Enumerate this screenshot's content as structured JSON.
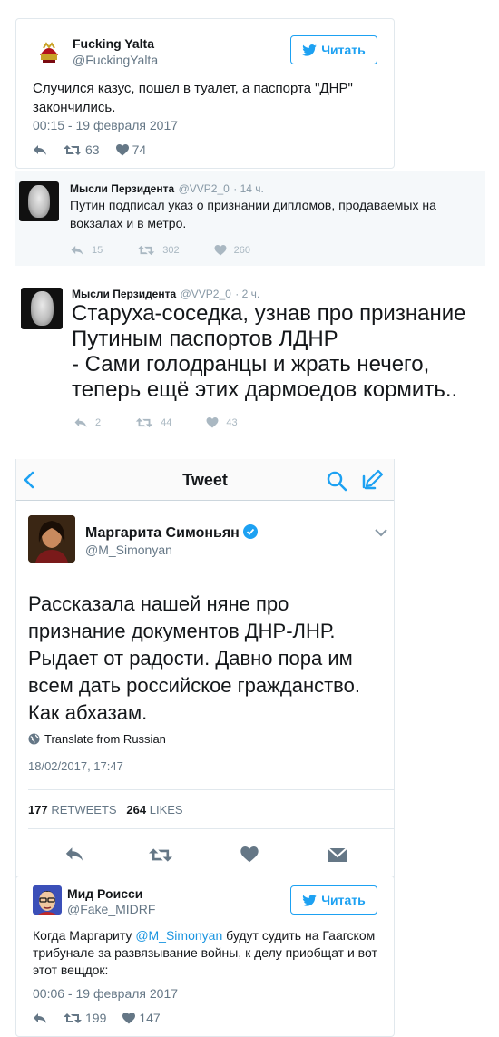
{
  "colors": {
    "accent": "#1da1f2",
    "gray": "#657786",
    "light_bg": "#f5f8fa"
  },
  "tweet1": {
    "name": "Fucking Yalta",
    "handle": "@FuckingYalta",
    "follow_label": "Читать",
    "text": "Случился казус, пошел в туалет, а паспорта \"ДНР\" закончились.",
    "date": "00:15 - 19 февраля 2017",
    "retweets": "63",
    "likes": "74"
  },
  "tweet2": {
    "name": "Мысли Перзидента",
    "handle": "@VVP2_0",
    "time": "· 14 ч.",
    "text": "Путин подписал указ о признании дипломов, продаваемых на вокзалах и в метро.",
    "replies": "15",
    "retweets": "302",
    "likes": "260"
  },
  "tweet3": {
    "name": "Мысли Перзидента",
    "handle": "@VVP2_0",
    "time": "· 2 ч.",
    "text": "Старуха-соседка, узнав про признание Путиным паспортов ЛДНР\n- Сами голодранцы и жрать нечего, теперь ещё этих дармоедов кормить..",
    "replies": "2",
    "retweets": "44",
    "likes": "43"
  },
  "ios_tweet": {
    "nav_title": "Tweet",
    "name": "Маргарита Симоньян",
    "handle": "@M_Simonyan",
    "text": "Рассказала нашей няне про признание документов ДНР-ЛНР. Рыдает от радости. Давно пора им всем дать российское гражданство. Как абхазам.",
    "translate_label": "Translate from Russian",
    "date": "18/02/2017, 17:47",
    "retweets_count": "177",
    "retweets_label": "RETWEETS",
    "likes_count": "264",
    "likes_label": "LIKES"
  },
  "tweet4": {
    "name": "Мид Роисси",
    "handle": "@Fake_MIDRF",
    "follow_label": "Читать",
    "text_before": "Когда Маргариту ",
    "mention": "@M_Simonyan",
    "text_after": " будут судить на Гаагском трибунале за развязывание войны, к делу приобщат и вот этот вещдок:",
    "date": "00:06 - 19 февраля 2017",
    "retweets": "199",
    "likes": "147"
  }
}
